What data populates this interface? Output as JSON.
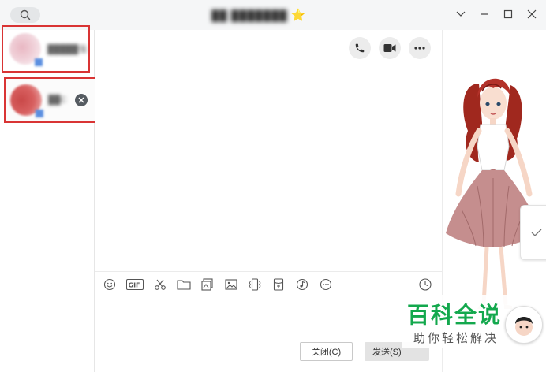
{
  "titlebar": {
    "title": "██ ███████",
    "star": "⭐"
  },
  "contacts": [
    {
      "name": "█████强",
      "avatar_color": "#f0d0d8"
    },
    {
      "name": "██C",
      "avatar_color": "#d86060"
    }
  ],
  "chat": {
    "actions": [
      "phone-icon",
      "video-call-icon",
      "more-icon"
    ],
    "toolbar": [
      "emoji-icon",
      "gif-icon",
      "scissors-icon",
      "folder-icon",
      "gallery-icon",
      "image-icon",
      "shake-icon",
      "red-packet-icon",
      "music-icon",
      "more-tools-icon"
    ],
    "close_button": "关闭(C)",
    "send_button": "发送(S)"
  },
  "watermark": {
    "title": "百科全说",
    "subtitle": "助你轻松解决",
    "color": "#13a84d"
  },
  "colors": {
    "highlight_border": "#d93434",
    "titlebar_bg": "#f5f6f7"
  }
}
